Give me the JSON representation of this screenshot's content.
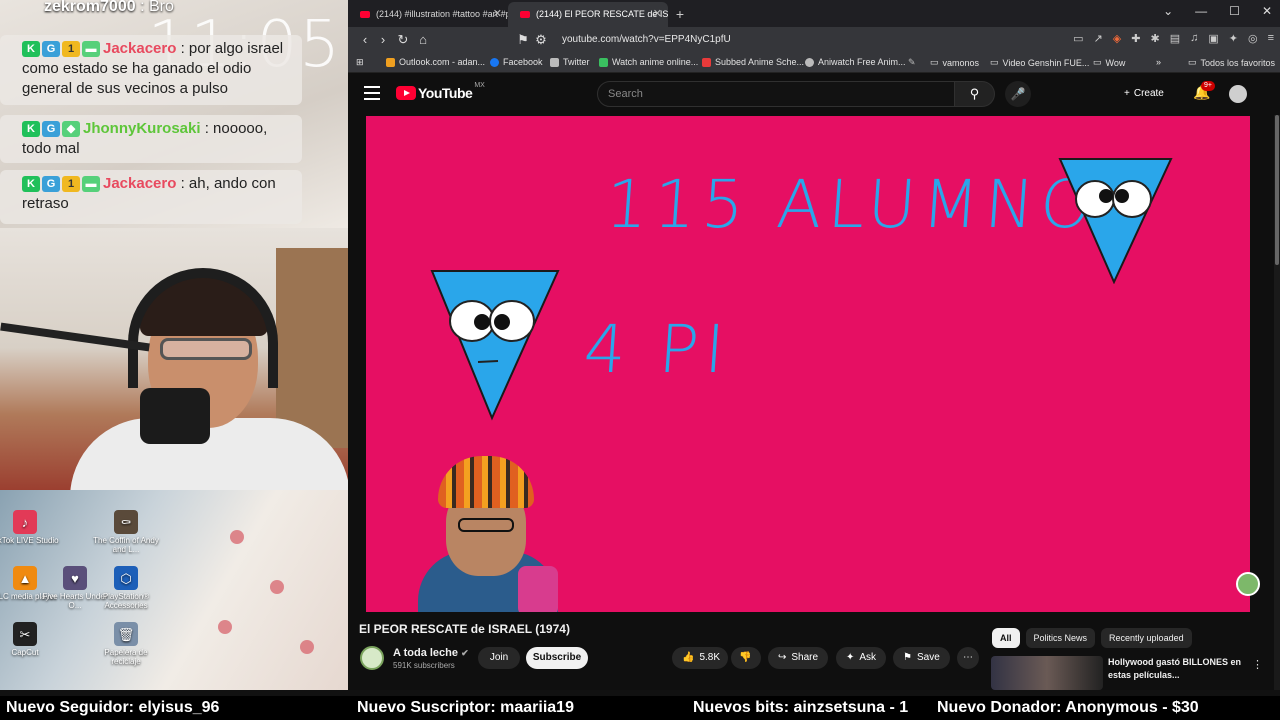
{
  "overlay": {
    "clock": "11:05",
    "chat": [
      {
        "user": "zekrom7000",
        "sep": " : ",
        "text": "Bro"
      },
      {
        "user": "Jackacero",
        "sep": " : ",
        "text": "por algo israel como estado se ha ganado el odio general de sus vecinos a pulso"
      },
      {
        "user": "JhonnyKurosaki",
        "sep": " : ",
        "text": "nooooo, todo mal"
      },
      {
        "user": "Jackacero",
        "sep": " : ",
        "text": "ah, ando con retraso"
      }
    ],
    "desktop_icons": [
      {
        "label": "TikTok LIVE Studio",
        "color": "#e23a57",
        "glyph": "♪"
      },
      {
        "label": "The Coffin of Andy and L...",
        "color": "#5a4a3a",
        "glyph": "⚰"
      },
      {
        "label": "VLC media player",
        "color": "#f08a10",
        "glyph": "▲"
      },
      {
        "label": "Five Hearts Under O...",
        "color": "#5a4f7a",
        "glyph": "♥"
      },
      {
        "label": "PlayStation® Accessories",
        "color": "#1d5fb8",
        "glyph": "⬡"
      },
      {
        "label": "CapCut",
        "color": "#222222",
        "glyph": "✂"
      },
      {
        "label": "Papelera de reciclaje",
        "color": "#7a8fa8",
        "glyph": "🗑"
      }
    ]
  },
  "browser": {
    "tabs": [
      {
        "title": "(2144) #illustration #tattoo #art #pc...",
        "active": false
      },
      {
        "title": "(2144) El PEOR RESCATE de IS...",
        "active": true
      }
    ],
    "url": "youtube.com/watch?v=EPP4NyC1pfU",
    "bookmarks": [
      {
        "label": "Outlook.com - adan...",
        "color": "#f0a020"
      },
      {
        "label": "Facebook",
        "color": "#1877f2"
      },
      {
        "label": "Twitter",
        "color": "#bbbbbb"
      },
      {
        "label": "Watch anime online...",
        "color": "#3ac060"
      },
      {
        "label": "Subbed Anime Sche...",
        "color": "#e83a3a"
      },
      {
        "label": "Aniwatch Free Anim...",
        "color": "#bbbbbb"
      },
      {
        "label": "vamonos",
        "color": "#cccccc"
      },
      {
        "label": "Video Genshin FUE...",
        "color": "#cccccc"
      },
      {
        "label": "Wow",
        "color": "#cccccc"
      },
      {
        "label": "Todos los favoritos",
        "color": "#cccccc"
      }
    ]
  },
  "youtube": {
    "logo": "YouTube",
    "country": "MX",
    "search_placeholder": "Search",
    "create_label": "Create",
    "notif_count": "9+",
    "video_text_1": "115 ALUMNOS",
    "video_text_2": "4 PI",
    "title": "El PEOR RESCATE de ISRAEL (1974)",
    "channel": "A toda leche",
    "verified": "✔",
    "subscribers": "591K subscribers",
    "join_label": "Join",
    "subscribe_label": "Subscribe",
    "likes": "5.8K",
    "share_label": "Share",
    "ask_label": "Ask",
    "save_label": "Save",
    "chips": [
      "All",
      "Politics News",
      "Recently uploaded"
    ],
    "recommended_title": "Hollywood gastó BILLONES en estas películas..."
  },
  "ticker": {
    "follower": "Nuevo Seguidor: elyisus_96",
    "subscriber": "Nuevo Suscriptor: maariia19",
    "bits": "Nuevos bits: ainzsetsuna - 1",
    "donor": "Nuevo Donador: Anonymous - $30"
  },
  "colors": {
    "video_bg": "#e60f63",
    "video_text": "#2aa6ea",
    "yt_red": "#ff0033",
    "chat_red": "#e84a5f",
    "chat_green": "#5ec63a"
  }
}
